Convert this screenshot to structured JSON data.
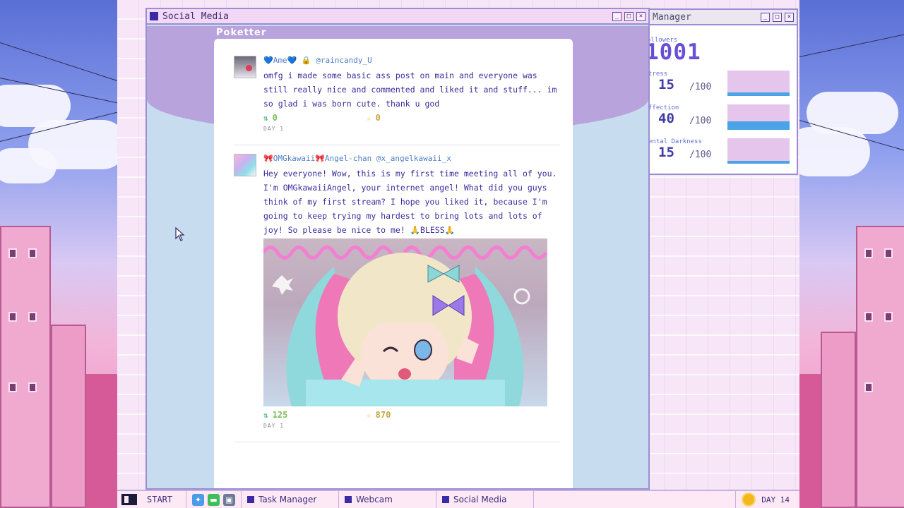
{
  "social_window": {
    "title": "Social Media",
    "app_name": "Poketter"
  },
  "posts": [
    {
      "display_name": "💙Ame💙 🔒",
      "handle": "@raincandy_U",
      "body": "omfg i made some basic ass post on main and everyone was still really nice and commented and liked it and stuff... im so glad i was born cute. thank u god",
      "retweets": "0",
      "favorites": "0",
      "day": "DAY 1"
    },
    {
      "display_name": "🎀OMGkawaii🎀Angel-chan",
      "handle": "@x_angelkawaii_x",
      "body": "Hey everyone! Wow, this is my first time meeting all of you. I'm OMGkawaiiAngel, your internet angel! What did you guys think of my first stream? I hope you liked it, because I'm going to keep trying my hardest to bring lots and lots of joy! So please be nice to me! 🙏BLESS🙏",
      "retweets": "125",
      "favorites": "870",
      "day": "DAY 1"
    }
  ],
  "stats_window": {
    "title": "Manager",
    "followers_label": "ollowers",
    "followers_value": "1001",
    "stats": [
      {
        "label": "tress",
        "value": "15",
        "max": "/100",
        "level": 0.15
      },
      {
        "label": "ffection",
        "value": "40",
        "max": "/100",
        "level": 0.4
      },
      {
        "label": "ental Darkness",
        "value": "15",
        "max": "/100",
        "level": 0.15
      }
    ]
  },
  "taskbar": {
    "start_label": "START",
    "tasks": [
      "Task Manager",
      "Webcam",
      "Social Media"
    ],
    "day_label": "DAY 14"
  },
  "colors": {
    "accent": "#3a2aa8",
    "link_blue": "#4f7fc4",
    "retweet_green": "#3db36e",
    "favorite_gold": "#e0b02a",
    "bar_blue": "#4aa3e6"
  },
  "icons": {
    "retweet": "retweet-icon",
    "favorite": "star-icon",
    "day": "sun-icon"
  }
}
